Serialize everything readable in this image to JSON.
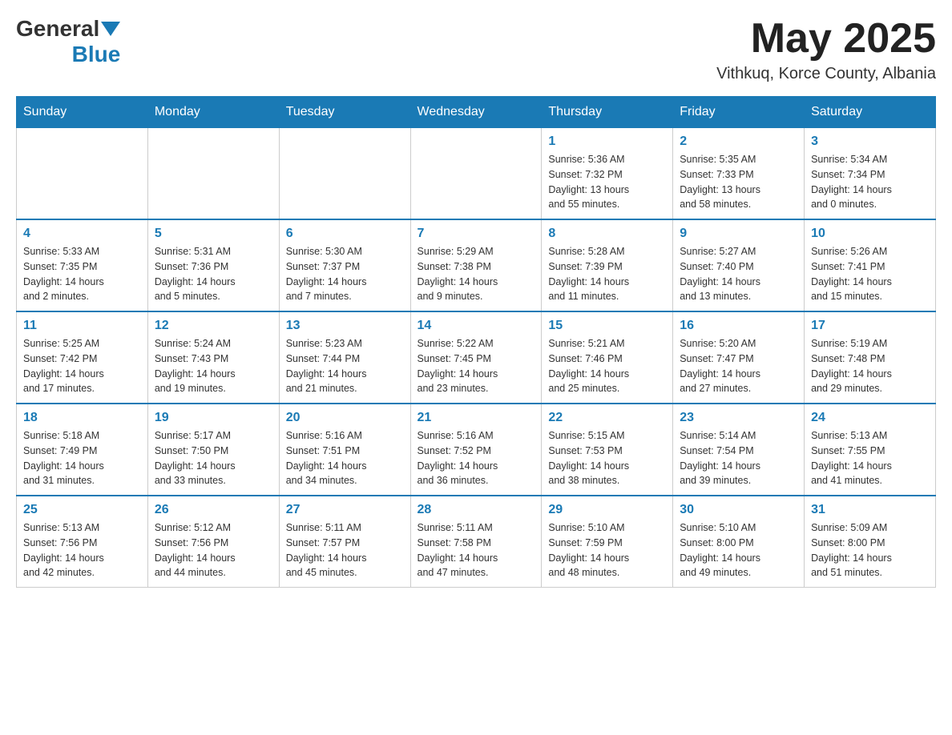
{
  "header": {
    "logo": {
      "general": "General",
      "blue": "Blue"
    },
    "title": "May 2025",
    "location": "Vithkuq, Korce County, Albania"
  },
  "calendar": {
    "days_of_week": [
      "Sunday",
      "Monday",
      "Tuesday",
      "Wednesday",
      "Thursday",
      "Friday",
      "Saturday"
    ],
    "weeks": [
      [
        {
          "day": "",
          "info": ""
        },
        {
          "day": "",
          "info": ""
        },
        {
          "day": "",
          "info": ""
        },
        {
          "day": "",
          "info": ""
        },
        {
          "day": "1",
          "info": "Sunrise: 5:36 AM\nSunset: 7:32 PM\nDaylight: 13 hours\nand 55 minutes."
        },
        {
          "day": "2",
          "info": "Sunrise: 5:35 AM\nSunset: 7:33 PM\nDaylight: 13 hours\nand 58 minutes."
        },
        {
          "day": "3",
          "info": "Sunrise: 5:34 AM\nSunset: 7:34 PM\nDaylight: 14 hours\nand 0 minutes."
        }
      ],
      [
        {
          "day": "4",
          "info": "Sunrise: 5:33 AM\nSunset: 7:35 PM\nDaylight: 14 hours\nand 2 minutes."
        },
        {
          "day": "5",
          "info": "Sunrise: 5:31 AM\nSunset: 7:36 PM\nDaylight: 14 hours\nand 5 minutes."
        },
        {
          "day": "6",
          "info": "Sunrise: 5:30 AM\nSunset: 7:37 PM\nDaylight: 14 hours\nand 7 minutes."
        },
        {
          "day": "7",
          "info": "Sunrise: 5:29 AM\nSunset: 7:38 PM\nDaylight: 14 hours\nand 9 minutes."
        },
        {
          "day": "8",
          "info": "Sunrise: 5:28 AM\nSunset: 7:39 PM\nDaylight: 14 hours\nand 11 minutes."
        },
        {
          "day": "9",
          "info": "Sunrise: 5:27 AM\nSunset: 7:40 PM\nDaylight: 14 hours\nand 13 minutes."
        },
        {
          "day": "10",
          "info": "Sunrise: 5:26 AM\nSunset: 7:41 PM\nDaylight: 14 hours\nand 15 minutes."
        }
      ],
      [
        {
          "day": "11",
          "info": "Sunrise: 5:25 AM\nSunset: 7:42 PM\nDaylight: 14 hours\nand 17 minutes."
        },
        {
          "day": "12",
          "info": "Sunrise: 5:24 AM\nSunset: 7:43 PM\nDaylight: 14 hours\nand 19 minutes."
        },
        {
          "day": "13",
          "info": "Sunrise: 5:23 AM\nSunset: 7:44 PM\nDaylight: 14 hours\nand 21 minutes."
        },
        {
          "day": "14",
          "info": "Sunrise: 5:22 AM\nSunset: 7:45 PM\nDaylight: 14 hours\nand 23 minutes."
        },
        {
          "day": "15",
          "info": "Sunrise: 5:21 AM\nSunset: 7:46 PM\nDaylight: 14 hours\nand 25 minutes."
        },
        {
          "day": "16",
          "info": "Sunrise: 5:20 AM\nSunset: 7:47 PM\nDaylight: 14 hours\nand 27 minutes."
        },
        {
          "day": "17",
          "info": "Sunrise: 5:19 AM\nSunset: 7:48 PM\nDaylight: 14 hours\nand 29 minutes."
        }
      ],
      [
        {
          "day": "18",
          "info": "Sunrise: 5:18 AM\nSunset: 7:49 PM\nDaylight: 14 hours\nand 31 minutes."
        },
        {
          "day": "19",
          "info": "Sunrise: 5:17 AM\nSunset: 7:50 PM\nDaylight: 14 hours\nand 33 minutes."
        },
        {
          "day": "20",
          "info": "Sunrise: 5:16 AM\nSunset: 7:51 PM\nDaylight: 14 hours\nand 34 minutes."
        },
        {
          "day": "21",
          "info": "Sunrise: 5:16 AM\nSunset: 7:52 PM\nDaylight: 14 hours\nand 36 minutes."
        },
        {
          "day": "22",
          "info": "Sunrise: 5:15 AM\nSunset: 7:53 PM\nDaylight: 14 hours\nand 38 minutes."
        },
        {
          "day": "23",
          "info": "Sunrise: 5:14 AM\nSunset: 7:54 PM\nDaylight: 14 hours\nand 39 minutes."
        },
        {
          "day": "24",
          "info": "Sunrise: 5:13 AM\nSunset: 7:55 PM\nDaylight: 14 hours\nand 41 minutes."
        }
      ],
      [
        {
          "day": "25",
          "info": "Sunrise: 5:13 AM\nSunset: 7:56 PM\nDaylight: 14 hours\nand 42 minutes."
        },
        {
          "day": "26",
          "info": "Sunrise: 5:12 AM\nSunset: 7:56 PM\nDaylight: 14 hours\nand 44 minutes."
        },
        {
          "day": "27",
          "info": "Sunrise: 5:11 AM\nSunset: 7:57 PM\nDaylight: 14 hours\nand 45 minutes."
        },
        {
          "day": "28",
          "info": "Sunrise: 5:11 AM\nSunset: 7:58 PM\nDaylight: 14 hours\nand 47 minutes."
        },
        {
          "day": "29",
          "info": "Sunrise: 5:10 AM\nSunset: 7:59 PM\nDaylight: 14 hours\nand 48 minutes."
        },
        {
          "day": "30",
          "info": "Sunrise: 5:10 AM\nSunset: 8:00 PM\nDaylight: 14 hours\nand 49 minutes."
        },
        {
          "day": "31",
          "info": "Sunrise: 5:09 AM\nSunset: 8:00 PM\nDaylight: 14 hours\nand 51 minutes."
        }
      ]
    ]
  }
}
